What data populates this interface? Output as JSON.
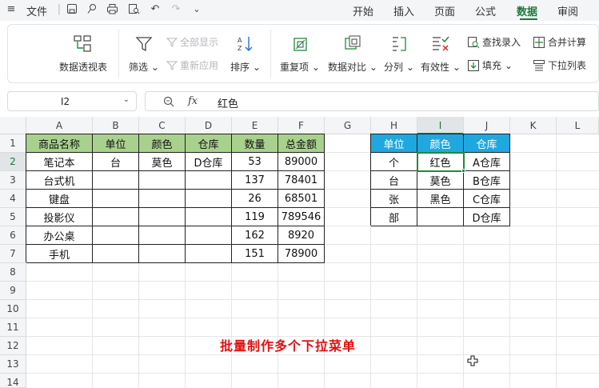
{
  "titlebar": {
    "file_label": "文件",
    "menu_tabs": [
      "开始",
      "插入",
      "页面",
      "公式",
      "数据",
      "审阅"
    ],
    "active_tab": "数据"
  },
  "ribbon": {
    "pivot": "数据透视表",
    "filter": "筛选",
    "show_all": "全部显示",
    "reapply": "重新应用",
    "sort": "排序",
    "duplicates": "重复项",
    "compare": "数据对比",
    "split": "分列",
    "validity": "有效性",
    "lookup_entry": "查找录入",
    "fill": "填充",
    "merge_calc": "合并计算",
    "dropdown_list": "下拉列表"
  },
  "formula_bar": {
    "name_box": "I2",
    "fx_label": "fx",
    "content": "红色"
  },
  "columns": [
    "A",
    "B",
    "C",
    "D",
    "E",
    "F",
    "G",
    "H",
    "I",
    "J",
    "K",
    "L"
  ],
  "rows": [
    "1",
    "2",
    "3",
    "4",
    "5",
    "6",
    "7",
    "8",
    "9",
    "10",
    "11",
    "12",
    "13",
    "14"
  ],
  "table_main": {
    "headers": [
      "商品名称",
      "单位",
      "颜色",
      "仓库",
      "数量",
      "总金额"
    ],
    "rows": [
      [
        "笔记本",
        "台",
        "莫色",
        "D仓库",
        "53",
        "89000"
      ],
      [
        "台式机",
        "",
        "",
        "",
        "137",
        "78401"
      ],
      [
        "键盘",
        "",
        "",
        "",
        "26",
        "68501"
      ],
      [
        "投影仪",
        "",
        "",
        "",
        "119",
        "789546"
      ],
      [
        "办公桌",
        "",
        "",
        "",
        "162",
        "8920"
      ],
      [
        "手机",
        "",
        "",
        "",
        "151",
        "78900"
      ]
    ]
  },
  "table_lists": {
    "headers": [
      "单位",
      "颜色",
      "仓库"
    ],
    "rows": [
      [
        "个",
        "红色",
        "A仓库"
      ],
      [
        "台",
        "莫色",
        "B仓库"
      ],
      [
        "张",
        "黑色",
        "C仓库"
      ],
      [
        "部",
        "",
        "D仓库"
      ]
    ]
  },
  "caption": "批量制作多个下拉菜单",
  "colors": {
    "accent_green": "#1f8a3a",
    "header_green": "#a9d18e",
    "header_blue": "#1fa8e0",
    "caption_red": "#e01010"
  }
}
